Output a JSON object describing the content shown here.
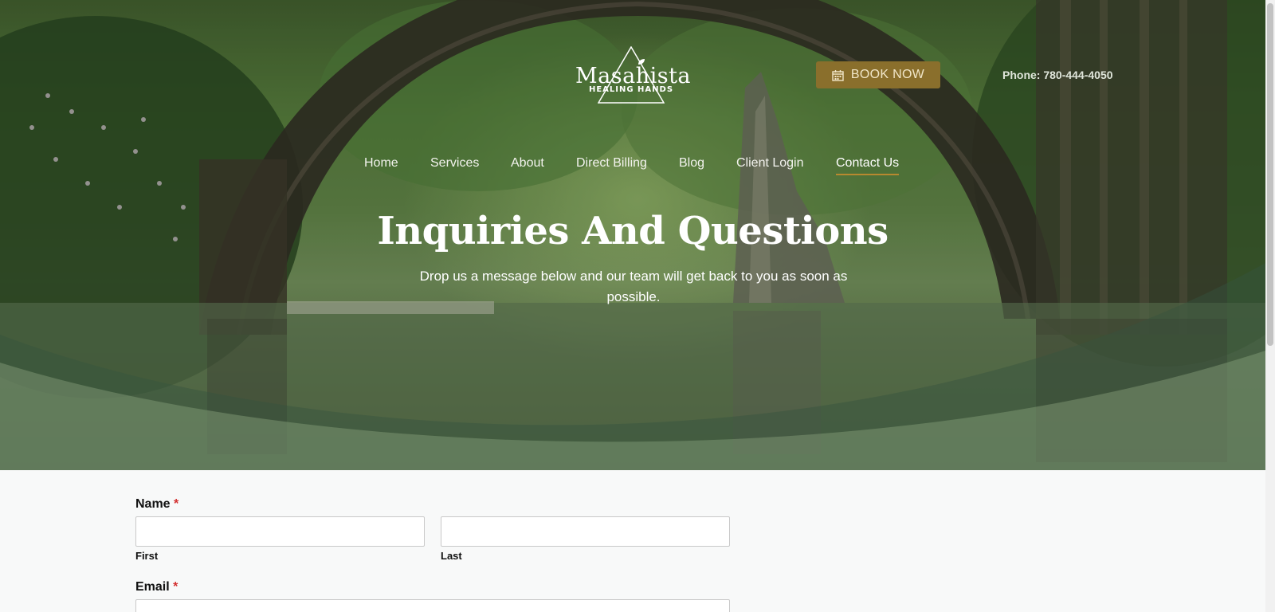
{
  "brand": {
    "name": "Masahista",
    "tagline": "HEALING HANDS"
  },
  "header": {
    "book_label": "BOOK NOW",
    "phone": "Phone: 780-444-4050"
  },
  "nav": {
    "items": [
      {
        "label": "Home"
      },
      {
        "label": "Services"
      },
      {
        "label": "About"
      },
      {
        "label": "Direct Billing"
      },
      {
        "label": "Blog"
      },
      {
        "label": "Client Login"
      },
      {
        "label": "Contact Us",
        "active": true
      }
    ]
  },
  "hero": {
    "title": "Inquiries And Questions",
    "subtitle": "Drop us a message below and our team will get back to you as soon as possible."
  },
  "form": {
    "name_label": "Name",
    "required_mark": "*",
    "first_label": "First",
    "last_label": "Last",
    "email_label": "Email"
  },
  "colors": {
    "accent": "#8a6f2c",
    "nav_underline": "#b8892f",
    "required": "#d32f2f"
  }
}
